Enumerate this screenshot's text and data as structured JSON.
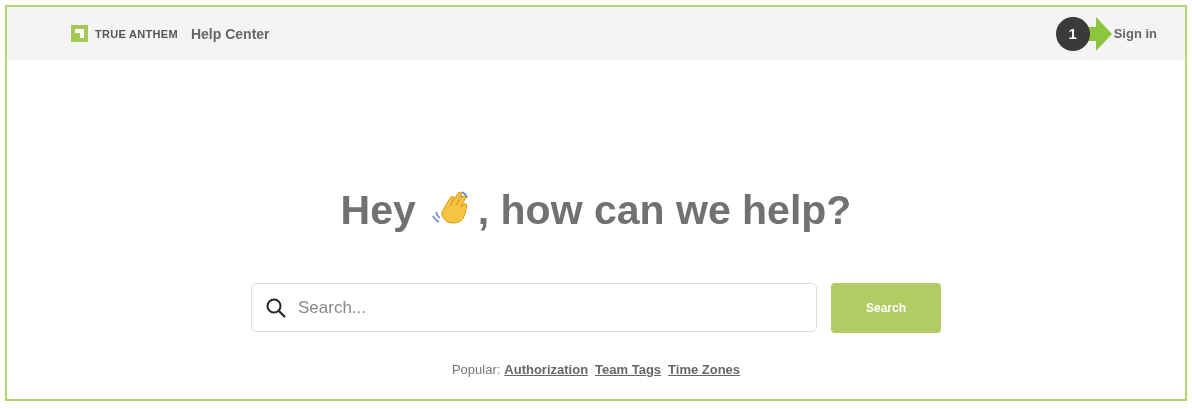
{
  "header": {
    "brand": "TRUE ANTHEM",
    "section": "Help Center",
    "sign_in": "Sign in",
    "callout": "1"
  },
  "hero": {
    "heading_start": "Hey",
    "heading_end": ", how can we help?"
  },
  "search": {
    "placeholder": "Search...",
    "button": "Search"
  },
  "popular": {
    "label": "Popular:",
    "links": [
      "Authorization",
      "Team Tags",
      "Time Zones"
    ]
  }
}
